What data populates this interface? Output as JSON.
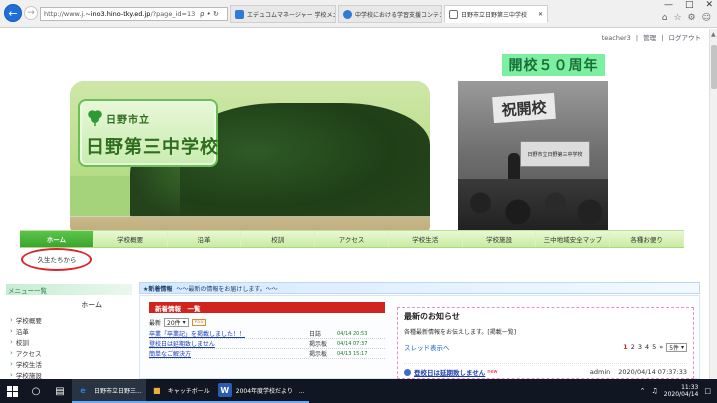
{
  "browser": {
    "url_prefix": "http://www.j.",
    "url_host": "~ino3.hino-tky.ed.jp",
    "url_path": "/?page_id=13",
    "addr_tools": "ρ • ↻",
    "tabs": [
      {
        "label": "エデュコムマネージャー 学校メニュー",
        "active": false,
        "color": "#2f7bd6"
      },
      {
        "label": "中学校における学習支援コンテン...",
        "active": false,
        "color": "#2f7bd6"
      },
      {
        "label": "日野市立日野第三中学校",
        "active": true,
        "color": "#6e6e6e"
      }
    ],
    "win_controls": [
      "—",
      "□",
      "✕"
    ],
    "toolbar_icons": [
      "⌂",
      "☆",
      "⚙",
      "☺"
    ]
  },
  "userbar": {
    "user": "teacher3",
    "sep": "|",
    "manage": "管理",
    "logout": "ログアウト"
  },
  "header": {
    "anniversary": "開校５０周年",
    "city": "日野市立",
    "school": "日野第三中学校",
    "banner_text": "祝開校",
    "board_text": "日野市立日野第三中学校"
  },
  "menu": [
    {
      "label": "ホーム",
      "home": true
    },
    {
      "label": "学校概要",
      "home": false
    },
    {
      "label": "沿革",
      "home": false
    },
    {
      "label": "校訓",
      "home": false
    },
    {
      "label": "アクセス",
      "home": false
    },
    {
      "label": "学校生活",
      "home": false
    },
    {
      "label": "学校施設",
      "home": false
    },
    {
      "label": "三中地域安全マップ",
      "home": false
    },
    {
      "label": "各種お便り",
      "home": false
    }
  ],
  "submenu_label": "久生たちから",
  "left": {
    "title": "メニュー一覧",
    "home": "ホーム",
    "items": [
      "学校概要",
      "沿革",
      "校訓",
      "アクセス",
      "学校生活",
      "学校施設"
    ]
  },
  "news_strip": {
    "label": "★新着情報",
    "text": "～～最新の情報をお届けします。～～"
  },
  "newinfo": {
    "title": "新着情報　一覧",
    "latest": "最新",
    "count_select": "20件",
    "rss": "RSS",
    "rows": [
      {
        "title": "卒業「卒業記」を掲載しました！！",
        "cat": "日誌",
        "date": "04/14 20:53"
      },
      {
        "title": "登校日は延期致しません",
        "cat": "掲示板",
        "date": "04/14 07:37"
      },
      {
        "title": "簡単なご解決方",
        "cat": "掲示板",
        "date": "04/13 15:17"
      }
    ]
  },
  "oshirase": {
    "title": "最新のお知らせ",
    "desc": "各種最新情報をお伝えします。[掲載一覧]",
    "thread_label": "スレッド表示へ",
    "pages": [
      "1",
      "2",
      "3",
      "4",
      "5",
      "»"
    ],
    "per_page": "5件",
    "row": {
      "title": "登校日は延期致しません",
      "new": "new",
      "author": "admin",
      "date": "2020/04/14 07:37:33"
    }
  },
  "taskbar": {
    "apps": [
      {
        "label": "日野市立日野三...",
        "icon": "e",
        "color": "#2a7ed8",
        "active": true
      },
      {
        "label": "キャッチボール",
        "icon": "■",
        "color": "#e6b23a",
        "active": false
      },
      {
        "label": "2004年度学校だより　...",
        "icon": "W",
        "color": "#2b5bb4",
        "active": false
      }
    ],
    "time": "11:33",
    "date": "2020/04/14"
  }
}
